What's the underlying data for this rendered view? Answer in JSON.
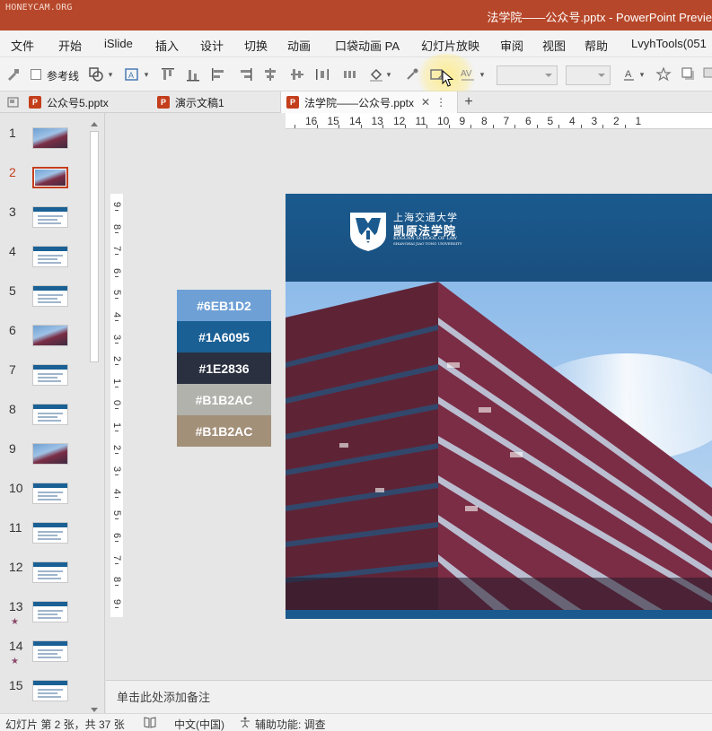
{
  "watermark": "HONEYCAM.ORG",
  "window_title": "法学院——公众号.pptx  -  PowerPoint Previe",
  "menu": [
    "文件",
    "开始",
    "iSlide",
    "插入",
    "设计",
    "切换",
    "动画",
    "口袋动画 PA",
    "幻灯片放映",
    "审阅",
    "视图",
    "帮助",
    "LvyhTools(051"
  ],
  "toolbar": {
    "guide_label": "参考线",
    "icons": [
      "format-painter-icon",
      "shape-icon",
      "textbox-icon",
      "align-top-icon",
      "align-bottom-icon",
      "align-left-icon",
      "align-right-icon",
      "align-middle-icon",
      "distribute-icon",
      "fill-color-icon",
      "eyedropper-icon",
      "outline-icon",
      "spacing-icon",
      "font-color-icon",
      "star-icon",
      "shadow-icon"
    ]
  },
  "tabs": [
    {
      "label": "公众号5.pptx"
    },
    {
      "label": "演示文稿1"
    },
    {
      "label": "法学院——公众号.pptx"
    }
  ],
  "thumbnails": [
    {
      "num": "1",
      "photo": true
    },
    {
      "num": "2",
      "photo": true,
      "selected": true
    },
    {
      "num": "3"
    },
    {
      "num": "4"
    },
    {
      "num": "5"
    },
    {
      "num": "6",
      "photo": true
    },
    {
      "num": "7"
    },
    {
      "num": "8"
    },
    {
      "num": "9",
      "photo": true
    },
    {
      "num": "10"
    },
    {
      "num": "11"
    },
    {
      "num": "12"
    },
    {
      "num": "13",
      "star": "★"
    },
    {
      "num": "14",
      "star": "★"
    },
    {
      "num": "15"
    }
  ],
  "hruler": [
    "16",
    "15",
    "14",
    "13",
    "12",
    "11",
    "10",
    "9",
    "8",
    "7",
    "6",
    "5",
    "4",
    "3",
    "2",
    "1"
  ],
  "vruler": [
    "9",
    "8",
    "7",
    "6",
    "5",
    "4",
    "3",
    "2",
    "1",
    "0",
    "1",
    "2",
    "3",
    "4",
    "5",
    "6",
    "7",
    "8",
    "9"
  ],
  "swatches": [
    {
      "label": "#6EB1D2",
      "color": "#6ea0d6"
    },
    {
      "label": "#1A6095",
      "color": "#1a6095"
    },
    {
      "label": "#1E2836",
      "color": "#2a3040"
    },
    {
      "label": "#B1B2AC",
      "color": "#b1b2ac"
    },
    {
      "label": "#B1B2AC",
      "color": "#a39079"
    }
  ],
  "slide": {
    "logo_cn_top": "上海交通大学",
    "logo_cn": "凯原法学院",
    "logo_en1": "KOGUAN SCHOOL OF LAW",
    "logo_en2": "SHANGHAI JIAO TONG UNIVERSITY",
    "header_color": "#1a5a8e"
  },
  "notes_placeholder": "单击此处添加备注",
  "status": {
    "slide_info": "幻灯片 第 2 张，共 37 张",
    "language": "中文(中国)",
    "accessibility": "辅助功能: 调查"
  }
}
